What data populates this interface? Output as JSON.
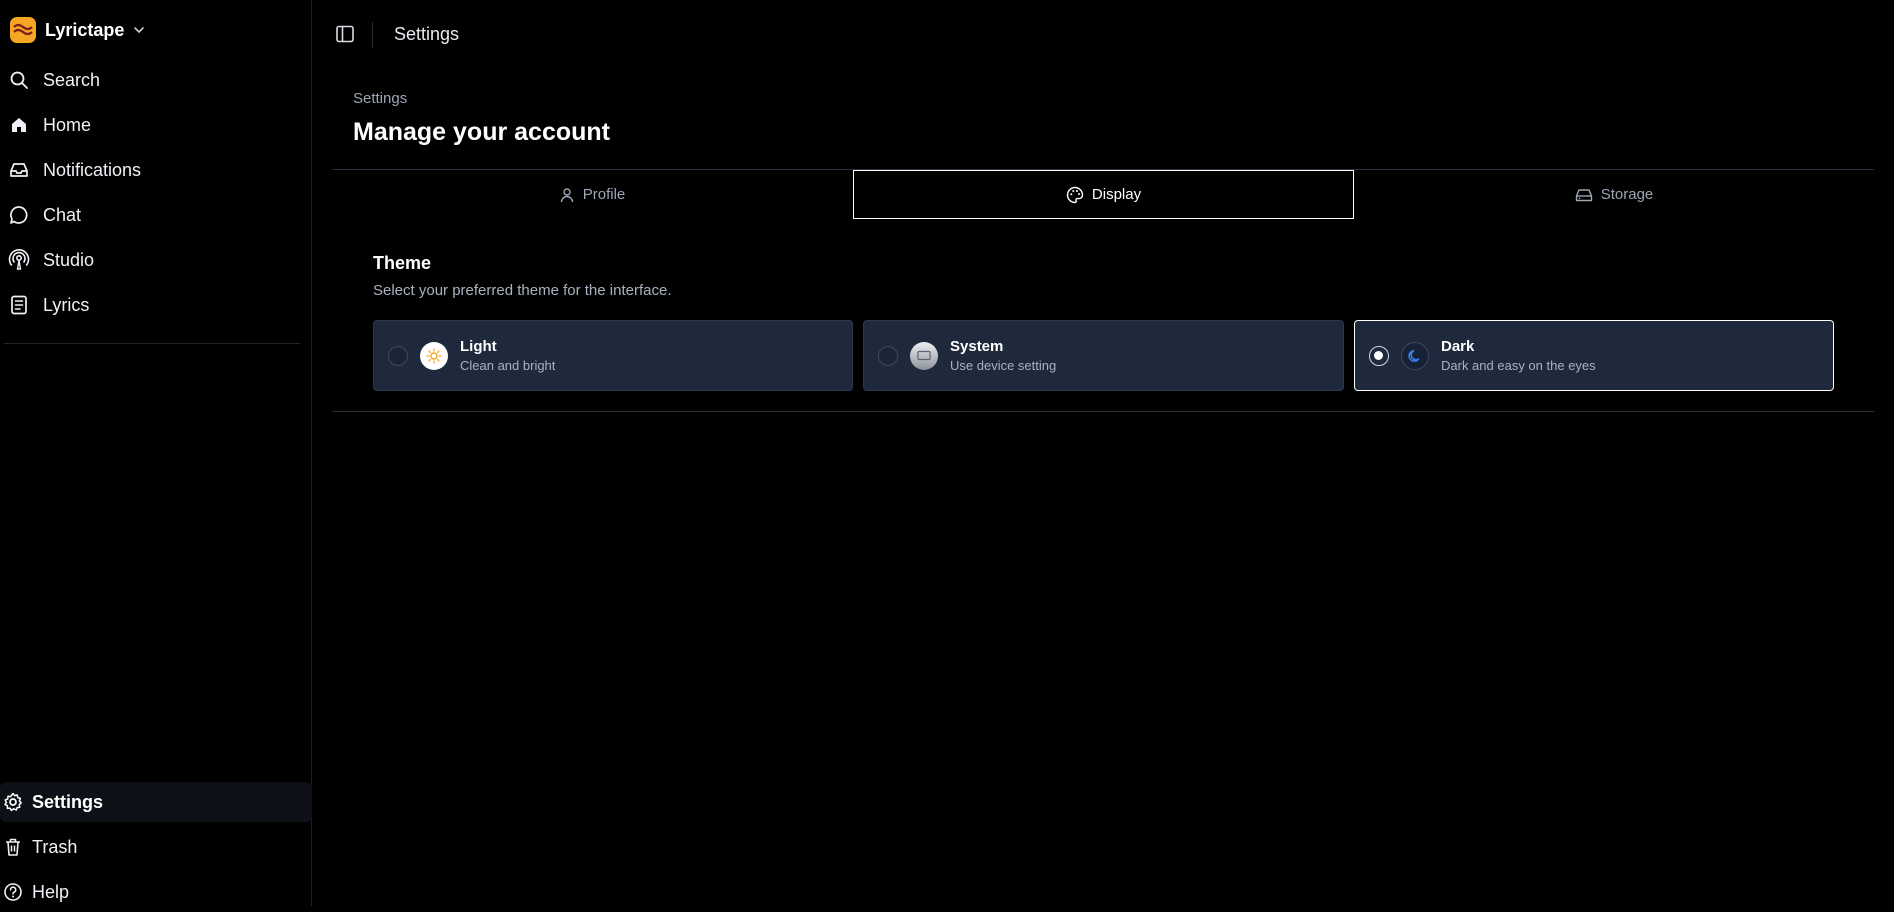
{
  "app": {
    "name": "Lyrictape"
  },
  "sidebar": {
    "items": [
      {
        "label": "Search",
        "icon": "search-icon"
      },
      {
        "label": "Home",
        "icon": "home-icon"
      },
      {
        "label": "Notifications",
        "icon": "inbox-icon"
      },
      {
        "label": "Chat",
        "icon": "chat-bubble-icon"
      },
      {
        "label": "Studio",
        "icon": "broadcast-icon"
      },
      {
        "label": "Lyrics",
        "icon": "document-icon"
      }
    ],
    "bottom": [
      {
        "label": "Settings",
        "icon": "gear-icon",
        "active": true
      },
      {
        "label": "Trash",
        "icon": "trash-icon"
      },
      {
        "label": "Help",
        "icon": "help-circle-icon"
      }
    ]
  },
  "header": {
    "title": "Settings"
  },
  "page": {
    "breadcrumb": "Settings",
    "title": "Manage your account"
  },
  "tabs": [
    {
      "label": "Profile",
      "icon": "user-icon"
    },
    {
      "label": "Display",
      "icon": "palette-icon",
      "active": true
    },
    {
      "label": "Storage",
      "icon": "hard-drive-icon"
    }
  ],
  "theme": {
    "title": "Theme",
    "description": "Select your preferred theme for the interface.",
    "options": [
      {
        "name": "Light",
        "subtitle": "Clean and bright",
        "icon": "sun-icon"
      },
      {
        "name": "System",
        "subtitle": "Use device setting",
        "icon": "monitor-icon"
      },
      {
        "name": "Dark",
        "subtitle": "Dark and easy on the eyes",
        "icon": "moon-icon",
        "selected": true
      }
    ]
  },
  "colors": {
    "background": "#000000",
    "card": "#1e293b",
    "brand": "#f5a623",
    "accent_blue": "#3b82f6"
  }
}
